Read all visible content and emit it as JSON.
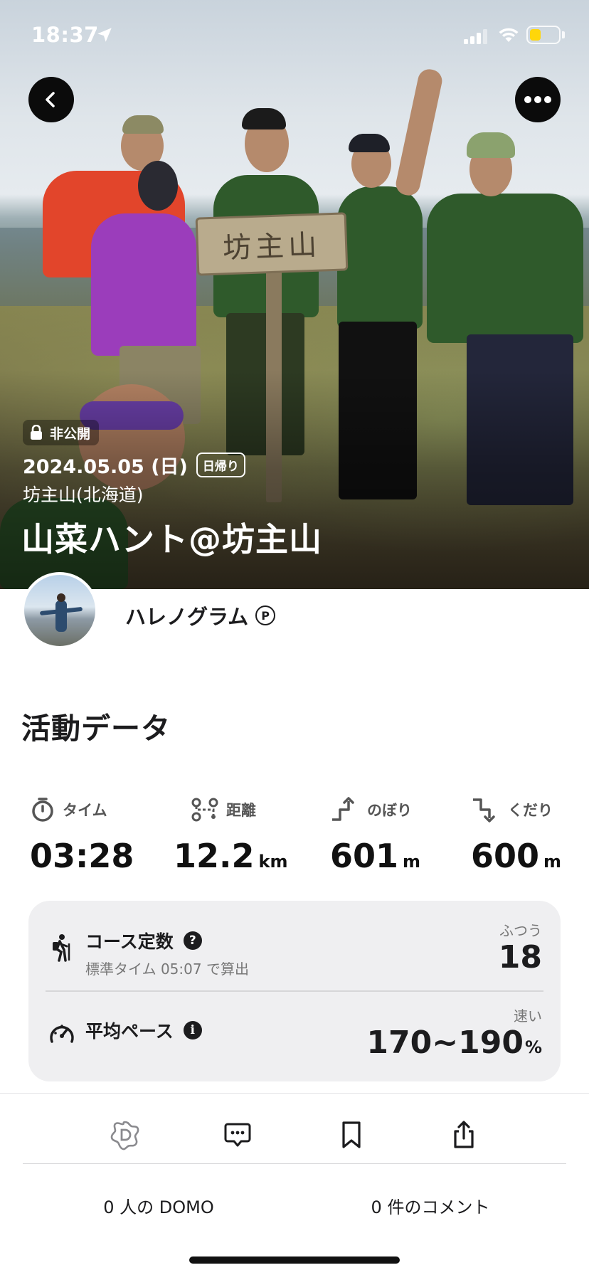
{
  "status_bar": {
    "time": "18:37",
    "battery_color": "#ffd60a"
  },
  "hero": {
    "sign_text": "坊主山",
    "privacy_label": "非公開",
    "date": "2024.05.05 (日)",
    "trip_type": "日帰り",
    "place": "坊主山(北海道)",
    "title": "山菜ハント@坊主山"
  },
  "user": {
    "name": "ハレノグラム",
    "badge": "P"
  },
  "section_title": "活動データ",
  "stats": [
    {
      "label": "タイム",
      "value": "03:28",
      "unit": "",
      "icon": "stopwatch-icon"
    },
    {
      "label": "距離",
      "value": "12.2",
      "unit": "km",
      "icon": "route-icon"
    },
    {
      "label": "のぼり",
      "value": "601",
      "unit": "m",
      "icon": "ascent-icon"
    },
    {
      "label": "くだり",
      "value": "600",
      "unit": "m",
      "icon": "descent-icon"
    }
  ],
  "course": {
    "label": "コース定数",
    "help": "?",
    "sub": "標準タイム 05:07 で算出",
    "level": "ふつう",
    "value": "18"
  },
  "pace": {
    "label": "平均ペース",
    "info": "i",
    "level": "速い",
    "value": "170~190",
    "unit": "%"
  },
  "bottom": {
    "domo_count": "0 人の DOMO",
    "comment_count": "0 件のコメント"
  }
}
